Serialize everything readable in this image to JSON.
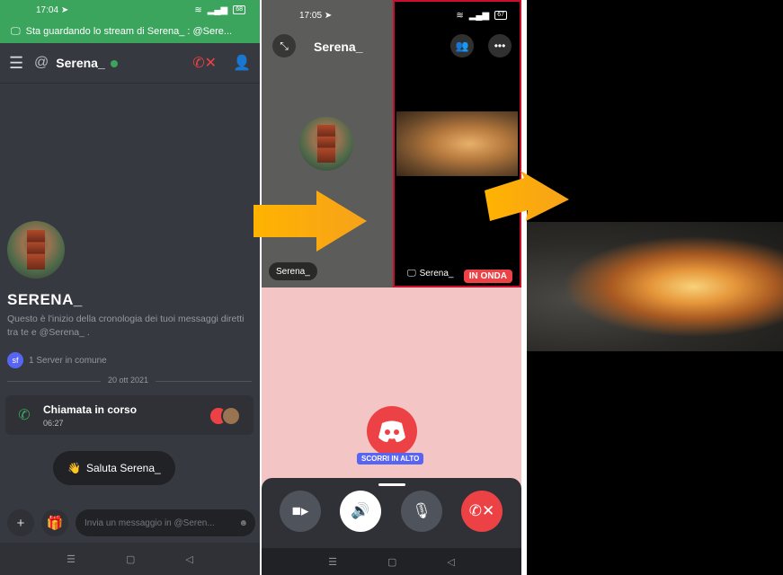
{
  "colors": {
    "discord_green": "#3ba55d",
    "discord_red": "#ed4245",
    "blurple": "#5865f2",
    "dark_bg": "#36393f",
    "arrow": "#f5a623"
  },
  "panel1": {
    "status": {
      "time": "17:04",
      "battery": "68"
    },
    "streambar": {
      "text": "Sta guardando lo stream di Serena_  : @Sere..."
    },
    "header": {
      "name": "Serena_"
    },
    "profile": {
      "name": "SERENA_",
      "intro": "Questo è l'inizio della cronologia dei tuoi messaggi diretti tra te e @Serena_ .",
      "server_icon": "sf",
      "server_text": "1 Server in comune"
    },
    "date": "20 ott 2021",
    "call": {
      "title": "Chiamata in corso",
      "time": "06:27"
    },
    "wave_label": "Saluta Serena_",
    "input": {
      "placeholder": "Invia un messaggio in @Seren..."
    }
  },
  "panel2": {
    "status": {
      "time": "17:05",
      "battery": "67"
    },
    "header": {
      "name": "Serena_"
    },
    "tiles": {
      "left_label": "Serena_",
      "right_label": "Serena_",
      "onair": "IN ONDA"
    },
    "scroll_label": "SCORRI IN ALTO"
  }
}
